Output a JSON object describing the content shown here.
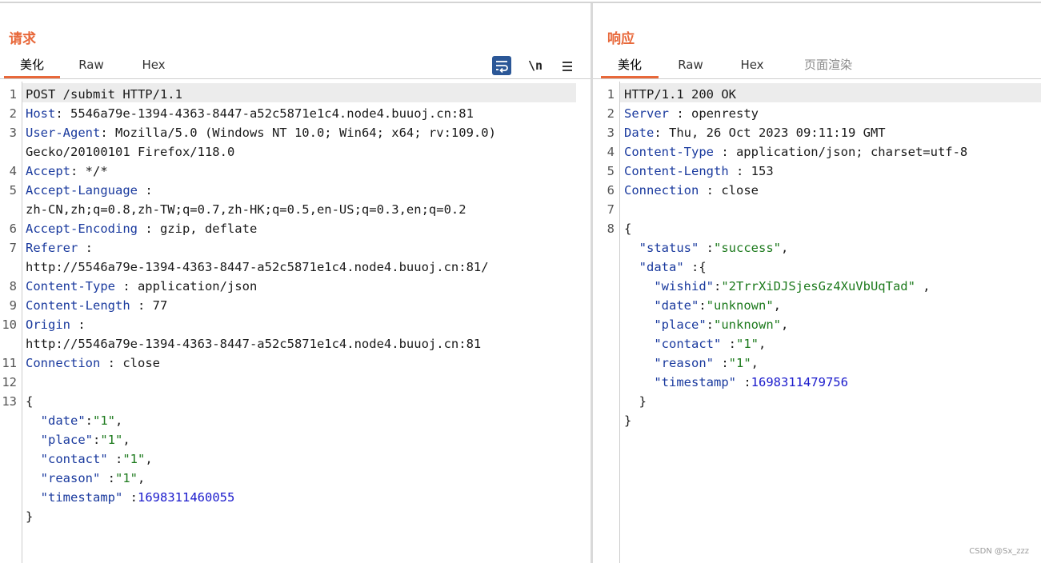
{
  "request": {
    "title": "请求",
    "tabs": [
      {
        "label": "美化",
        "active": true
      },
      {
        "label": "Raw",
        "active": false
      },
      {
        "label": "Hex",
        "active": false
      }
    ],
    "toolbar": {
      "newline_label": "\\n",
      "wrap_icon": "word-wrap-icon",
      "menu_icon": "hamburger-menu-icon"
    },
    "lines": [
      {
        "num": "1",
        "rows": [
          [
            [
              "POST /submit HTTP/1.1",
              "p"
            ]
          ]
        ]
      },
      {
        "num": "2",
        "rows": [
          [
            [
              "Host",
              "k"
            ],
            [
              ": 5546a79e-1394-4363-8447-a52c5871e1c4.node4.buuoj.cn:81",
              "p"
            ]
          ]
        ]
      },
      {
        "num": "3",
        "rows": [
          [
            [
              "User-Agent",
              "k"
            ],
            [
              ": Mozilla/5.0 (Windows NT 10.0; Win64; x64; rv:109.0)",
              "p"
            ]
          ],
          [
            [
              "Gecko/20100101 Firefox/118.0",
              "p"
            ]
          ]
        ]
      },
      {
        "num": "4",
        "rows": [
          [
            [
              "Accept",
              "k"
            ],
            [
              ": */*",
              "p"
            ]
          ]
        ]
      },
      {
        "num": "5",
        "rows": [
          [
            [
              "Accept-Language",
              "k"
            ],
            [
              " :",
              "p"
            ]
          ],
          [
            [
              "zh-CN,zh;q=0.8,zh-TW;q=0.7,zh-HK;q=0.5,en-US;q=0.3,en;q=0.2",
              "p"
            ]
          ]
        ]
      },
      {
        "num": "6",
        "rows": [
          [
            [
              "Accept-Encoding",
              "k"
            ],
            [
              " : gzip, deflate",
              "p"
            ]
          ]
        ]
      },
      {
        "num": "7",
        "rows": [
          [
            [
              "Referer",
              "k"
            ],
            [
              " :",
              "p"
            ]
          ],
          [
            [
              "http://5546a79e-1394-4363-8447-a52c5871e1c4.node4.buuoj.cn:81/",
              "p"
            ]
          ]
        ]
      },
      {
        "num": "8",
        "rows": [
          [
            [
              "Content-Type",
              "k"
            ],
            [
              " : application/json",
              "p"
            ]
          ]
        ]
      },
      {
        "num": "9",
        "rows": [
          [
            [
              "Content-Length",
              "k"
            ],
            [
              " : 77",
              "p"
            ]
          ]
        ]
      },
      {
        "num": "10",
        "rows": [
          [
            [
              "Origin",
              "k"
            ],
            [
              " :",
              "p"
            ]
          ],
          [
            [
              "http://5546a79e-1394-4363-8447-a52c5871e1c4.node4.buuoj.cn:81",
              "p"
            ]
          ]
        ]
      },
      {
        "num": "11",
        "rows": [
          [
            [
              "Connection",
              "k"
            ],
            [
              " : close",
              "p"
            ]
          ]
        ]
      },
      {
        "num": "12",
        "rows": [
          []
        ]
      },
      {
        "num": "13",
        "rows": [
          [
            [
              "{",
              "p"
            ]
          ],
          [
            [
              "  ",
              "p"
            ],
            [
              "\"date\"",
              "k"
            ],
            [
              ":",
              "p"
            ],
            [
              "\"1\"",
              "s"
            ],
            [
              ",",
              "p"
            ]
          ],
          [
            [
              "  ",
              "p"
            ],
            [
              "\"place\"",
              "k"
            ],
            [
              ":",
              "p"
            ],
            [
              "\"1\"",
              "s"
            ],
            [
              ",",
              "p"
            ]
          ],
          [
            [
              "  ",
              "p"
            ],
            [
              "\"contact\"",
              "k"
            ],
            [
              " :",
              "p"
            ],
            [
              "\"1\"",
              "s"
            ],
            [
              ",",
              "p"
            ]
          ],
          [
            [
              "  ",
              "p"
            ],
            [
              "\"reason\"",
              "k"
            ],
            [
              " :",
              "p"
            ],
            [
              "\"1\"",
              "s"
            ],
            [
              ",",
              "p"
            ]
          ],
          [
            [
              "  ",
              "p"
            ],
            [
              "\"timestamp\"",
              "k"
            ],
            [
              " :",
              "p"
            ],
            [
              "1698311460055",
              "n"
            ]
          ],
          [
            [
              "}",
              "p"
            ]
          ]
        ]
      }
    ]
  },
  "response": {
    "title": "响应",
    "tabs": [
      {
        "label": "美化",
        "active": true
      },
      {
        "label": "Raw",
        "active": false
      },
      {
        "label": "Hex",
        "active": false
      },
      {
        "label": "页面渲染",
        "active": false,
        "disabled": true
      }
    ],
    "lines": [
      {
        "num": "1",
        "rows": [
          [
            [
              "HTTP/1.1 200 OK",
              "p"
            ]
          ]
        ]
      },
      {
        "num": "2",
        "rows": [
          [
            [
              "Server",
              "k"
            ],
            [
              " : openresty",
              "p"
            ]
          ]
        ]
      },
      {
        "num": "3",
        "rows": [
          [
            [
              "Date",
              "k"
            ],
            [
              ": Thu, 26 Oct 2023 09:11:19 GMT",
              "p"
            ]
          ]
        ]
      },
      {
        "num": "4",
        "rows": [
          [
            [
              "Content-Type",
              "k"
            ],
            [
              " : application/json; charset=utf-8",
              "p"
            ]
          ]
        ]
      },
      {
        "num": "5",
        "rows": [
          [
            [
              "Content-Length",
              "k"
            ],
            [
              " : 153",
              "p"
            ]
          ]
        ]
      },
      {
        "num": "6",
        "rows": [
          [
            [
              "Connection",
              "k"
            ],
            [
              " : close",
              "p"
            ]
          ]
        ]
      },
      {
        "num": "7",
        "rows": [
          []
        ]
      },
      {
        "num": "8",
        "rows": [
          [
            [
              "{",
              "p"
            ]
          ],
          [
            [
              "  ",
              "p"
            ],
            [
              "\"status\"",
              "k"
            ],
            [
              " :",
              "p"
            ],
            [
              "\"success\"",
              "s"
            ],
            [
              ",",
              "p"
            ]
          ],
          [
            [
              "  ",
              "p"
            ],
            [
              "\"data\"",
              "k"
            ],
            [
              " :{",
              "p"
            ]
          ],
          [
            [
              "    ",
              "p"
            ],
            [
              "\"wishid\"",
              "k"
            ],
            [
              ":",
              "p"
            ],
            [
              "\"2TrrXiDJSjesGz4XuVbUqTad\"",
              "s"
            ],
            [
              " ,",
              "p"
            ]
          ],
          [
            [
              "    ",
              "p"
            ],
            [
              "\"date\"",
              "k"
            ],
            [
              ":",
              "p"
            ],
            [
              "\"unknown\"",
              "s"
            ],
            [
              ",",
              "p"
            ]
          ],
          [
            [
              "    ",
              "p"
            ],
            [
              "\"place\"",
              "k"
            ],
            [
              ":",
              "p"
            ],
            [
              "\"unknown\"",
              "s"
            ],
            [
              ",",
              "p"
            ]
          ],
          [
            [
              "    ",
              "p"
            ],
            [
              "\"contact\"",
              "k"
            ],
            [
              " :",
              "p"
            ],
            [
              "\"1\"",
              "s"
            ],
            [
              ",",
              "p"
            ]
          ],
          [
            [
              "    ",
              "p"
            ],
            [
              "\"reason\"",
              "k"
            ],
            [
              " :",
              "p"
            ],
            [
              "\"1\"",
              "s"
            ],
            [
              ",",
              "p"
            ]
          ],
          [
            [
              "    ",
              "p"
            ],
            [
              "\"timestamp\"",
              "k"
            ],
            [
              " :",
              "p"
            ],
            [
              "1698311479756",
              "n"
            ]
          ],
          [
            [
              "  }",
              "p"
            ]
          ],
          [
            [
              "}",
              "p"
            ]
          ]
        ]
      }
    ]
  },
  "watermark": "CSDN @Sx_zzz",
  "colors": {
    "accent": "#e8683a",
    "key": "#1a3a9e",
    "string": "#1d7a1d",
    "number": "#1a1acc",
    "wrap_button": "#2b5797"
  }
}
